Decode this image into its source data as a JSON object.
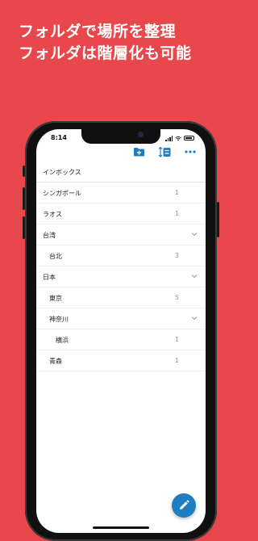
{
  "headline": {
    "line1": "フォルダで場所を整理",
    "line2": "フォルダは階層化も可能"
  },
  "status_bar": {
    "time": "8:14"
  },
  "toolbar": {
    "icons": [
      "add-folder-icon",
      "reorder-list-icon",
      "more-icon"
    ],
    "accent": "#1F7EC1"
  },
  "folders": [
    {
      "label": "インボックス",
      "count": "",
      "level": 0,
      "chevron": false
    },
    {
      "label": "シンガポール",
      "count": "1",
      "level": 0,
      "chevron": false
    },
    {
      "label": "ラオス",
      "count": "1",
      "level": 0,
      "chevron": false
    },
    {
      "label": "台湾",
      "count": "",
      "level": 0,
      "chevron": true
    },
    {
      "label": "台北",
      "count": "3",
      "level": 1,
      "chevron": false
    },
    {
      "label": "日本",
      "count": "",
      "level": 0,
      "chevron": true
    },
    {
      "label": "東京",
      "count": "5",
      "level": 1,
      "chevron": false
    },
    {
      "label": "神奈川",
      "count": "",
      "level": 1,
      "chevron": true
    },
    {
      "label": "横浜",
      "count": "1",
      "level": 2,
      "chevron": false
    },
    {
      "label": "青森",
      "count": "1",
      "level": 1,
      "chevron": false
    }
  ],
  "fab": {
    "icon": "pencil-icon",
    "color": "#1F7EC1"
  },
  "colors": {
    "background": "#E8474C"
  }
}
